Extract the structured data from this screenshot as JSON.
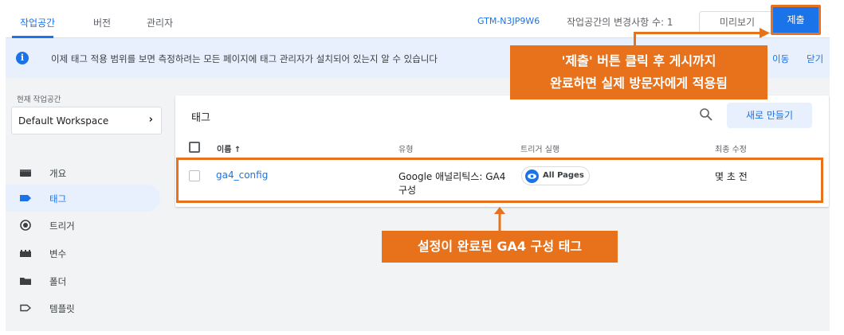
{
  "tabs": [
    "작업공간",
    "버전",
    "관리자"
  ],
  "header": {
    "container_id": "GTM-N3JP9W6",
    "changes_text": "작업공간의 변경사항 수: 1",
    "preview_label": "미리보기",
    "submit_label": "제출"
  },
  "banner": {
    "text": "이제 태그 적용 범위를 보면 측정하려는 모든 페이지에 태그 관리자가 설치되어 있는지 알 수 있습니다",
    "move_label": "이동",
    "close_label": "닫기"
  },
  "sidebar": {
    "workspace_label": "현재 작업공간",
    "workspace_name": "Default Workspace",
    "items": [
      {
        "label": "개요",
        "icon": "overview-icon"
      },
      {
        "label": "태그",
        "icon": "tag-icon"
      },
      {
        "label": "트리거",
        "icon": "trigger-icon"
      },
      {
        "label": "변수",
        "icon": "variables-icon"
      },
      {
        "label": "폴더",
        "icon": "folder-icon"
      },
      {
        "label": "템플릿",
        "icon": "template-icon"
      }
    ]
  },
  "tags_card": {
    "title": "태그",
    "new_label": "새로 만들기",
    "columns": [
      "이름 ↑",
      "유형",
      "트리거 실행",
      "최종 수정"
    ],
    "rows": [
      {
        "name": "ga4_config",
        "type_line1": "Google 애널리틱스: GA4",
        "type_line2": "구성",
        "trigger": "All Pages",
        "modified": "몇 초 전"
      }
    ]
  },
  "annotations": {
    "top_line1": "'제출' 버튼 클릭 후 게시까지",
    "top_line2": "완료하면 실제 방문자에게 적용됨",
    "bottom": "설정이 완료된 GA4 구성 태그"
  },
  "colors": {
    "accent": "#1a73e8",
    "highlight": "#e8711c",
    "banner_bg": "#e8f0fe"
  }
}
